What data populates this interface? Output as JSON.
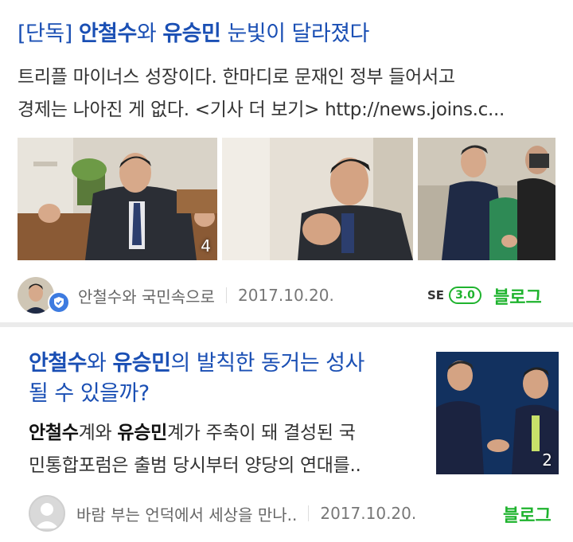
{
  "post1": {
    "title_tag": "[단독]",
    "title_kw1": "안철수",
    "title_mid": "와",
    "title_kw2": "유승민",
    "title_rest": "눈빛이 달라졌다",
    "desc_line1": "트리플 마이너스 성장이다. 한마디로 문재인 정부 들어서고",
    "desc_line2": "경제는 나아진 게 없다. <기사 더 보기> http://news.joins.c...",
    "image_count": "4",
    "author": "안철수와 국민속으로",
    "date": "2017.10.20.",
    "se_label": "SE",
    "se_version": "3.0",
    "source": "블로그"
  },
  "post2": {
    "title_kw1": "안철수",
    "title_mid": "와",
    "title_kw2": "유승민",
    "title_rest1": "의 발칙한 동거는 성사",
    "title_line2": "될 수 있을까?",
    "desc_kw1": "안철수",
    "desc_a": "계와",
    "desc_kw2": "유승민",
    "desc_b": "계가 주축이 돼 결성된 국",
    "desc_line2": "민통합포럼은 출범 당시부터 양당의 연대를..",
    "image_count": "2",
    "author": "바람 부는 언덕에서 세상을 만나..",
    "date": "2017.10.20.",
    "source": "블로그"
  },
  "colors": {
    "title_blue": "#1a4fb4",
    "blog_green": "#1fb32e",
    "badge_blue": "#3d7be0"
  },
  "icons": [
    "verified-badge-icon",
    "default-avatar-icon"
  ]
}
